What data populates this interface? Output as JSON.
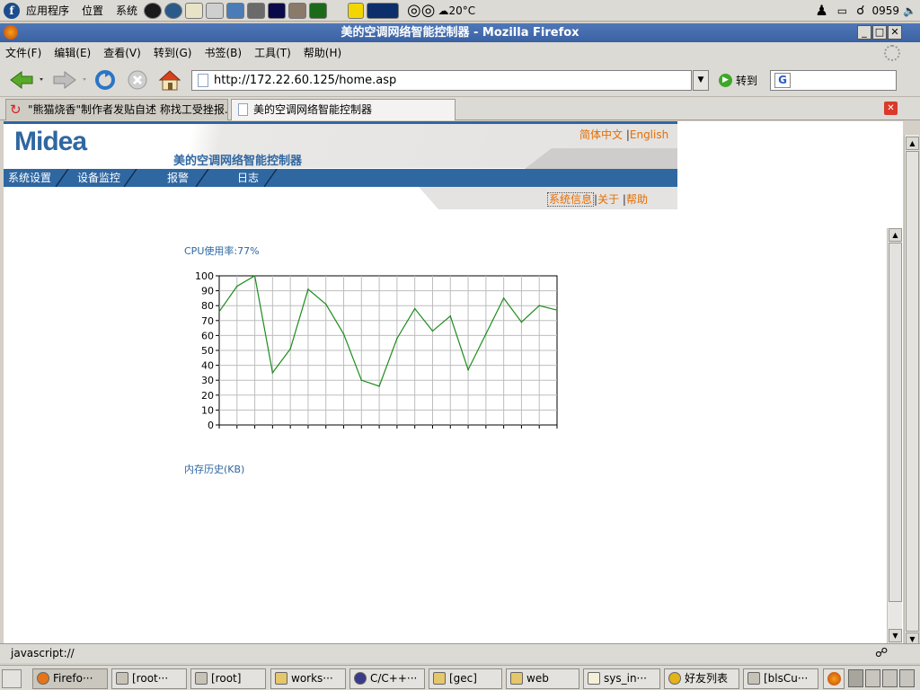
{
  "top_panel": {
    "menus": [
      "应用程序",
      "位置",
      "系统"
    ],
    "temperature": "20°C",
    "clock": "0959"
  },
  "window": {
    "title": "美的空调网络智能控制器 - Mozilla Firefox",
    "menu": [
      "文件(F)",
      "编辑(E)",
      "查看(V)",
      "转到(G)",
      "书签(B)",
      "工具(T)",
      "帮助(H)"
    ],
    "url": "http://172.22.60.125/home.asp",
    "go_label": "转到",
    "search_icon": "G"
  },
  "tabs": [
    {
      "label": "\"熊猫烧香\"制作者发贴自述 称找工受挫报...",
      "active": false
    },
    {
      "label": "美的空调网络智能控制器",
      "active": true
    }
  ],
  "page": {
    "logo": "Midea",
    "title": "美的空调网络智能控制器",
    "lang_cn": "简体中文",
    "lang_en": "English",
    "nav": [
      "系统设置",
      "设备监控",
      "报警",
      "日志"
    ],
    "sub_nav": [
      "系统信息",
      "关于",
      "帮助"
    ],
    "cpu_label": "CPU使用率:77%",
    "memory_label": "内存历史(KB)"
  },
  "status": {
    "text": "javascript://"
  },
  "taskbar": [
    "Firefo···",
    "[root···",
    "[root]",
    "works···",
    "C/C++···",
    "[gec]",
    "web",
    "sys_in···",
    "好友列表",
    "[blsCu···"
  ],
  "chart_data": {
    "type": "line",
    "x": [
      0,
      1,
      2,
      3,
      4,
      5,
      6,
      7,
      8,
      9,
      10,
      11,
      12,
      13,
      14,
      15,
      16,
      17,
      18,
      19
    ],
    "series": [
      {
        "values": [
          76,
          93,
          100,
          35,
          51,
          91,
          81,
          61,
          30,
          26,
          58,
          78,
          63,
          73,
          37,
          61,
          85,
          69,
          80,
          77
        ],
        "color": "#1d8c1d"
      }
    ],
    "yticks": [
      0,
      10,
      20,
      30,
      40,
      50,
      60,
      70,
      80,
      90,
      100
    ],
    "ylim": [
      0,
      100
    ],
    "grid": true,
    "title": "CPU使用率:77%"
  }
}
